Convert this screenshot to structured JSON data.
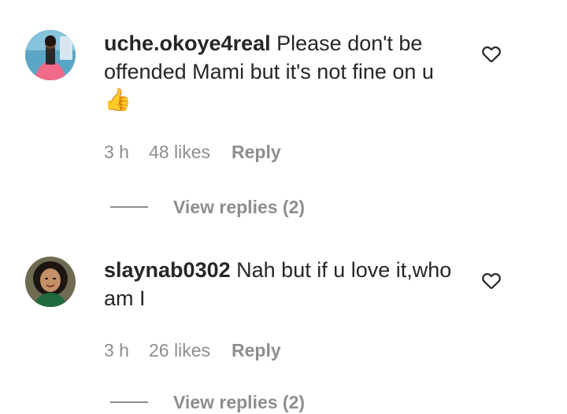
{
  "comments": [
    {
      "username": "uche.okoye4real",
      "text": "Please don't be offended Mami but it's not fine on u",
      "emoji": "👍",
      "time": "3 h",
      "likes": "48 likes",
      "reply_label": "Reply",
      "view_replies": "View replies (2)"
    },
    {
      "username": "slaynab0302",
      "text": "Nah but if u love it,who am I",
      "time": "3 h",
      "likes": "26 likes",
      "reply_label": "Reply",
      "view_replies": "View replies (2)"
    }
  ],
  "icons": {
    "like": "heart-outline-icon"
  },
  "colors": {
    "text": "#262626",
    "secondary": "#8e8e8e"
  }
}
